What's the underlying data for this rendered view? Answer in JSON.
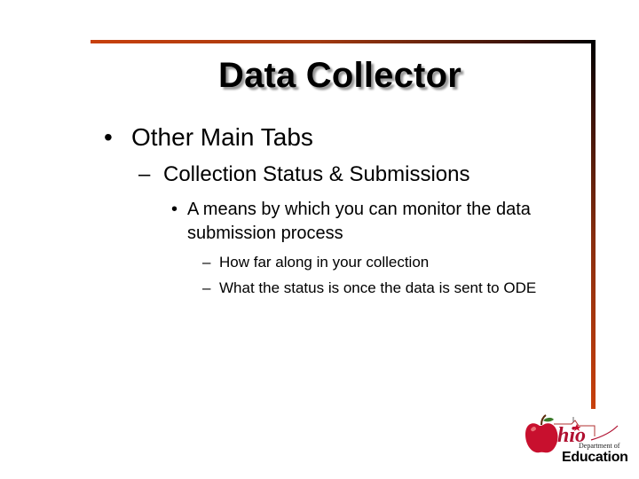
{
  "slide": {
    "title": "Data Collector",
    "bullets": {
      "level1": {
        "marker": "•",
        "text": "Other Main Tabs"
      },
      "level2": {
        "marker": "–",
        "text": "Collection Status & Submissions"
      },
      "level3": {
        "marker": "•",
        "text": "A means by which you can monitor the data submission process"
      },
      "level4": [
        {
          "marker": "–",
          "text": "How far along in your collection"
        },
        {
          "marker": "–",
          "text": "What the status is once the data is sent to ODE"
        }
      ]
    },
    "accent_colors": {
      "rule_orange": "#c8400c",
      "rule_dark": "#000000"
    }
  },
  "logo": {
    "icon": "apple-icon",
    "script_text": "Ohio",
    "department_text": "Department of",
    "education_text": "Education",
    "apple_color": "#c8102e"
  }
}
